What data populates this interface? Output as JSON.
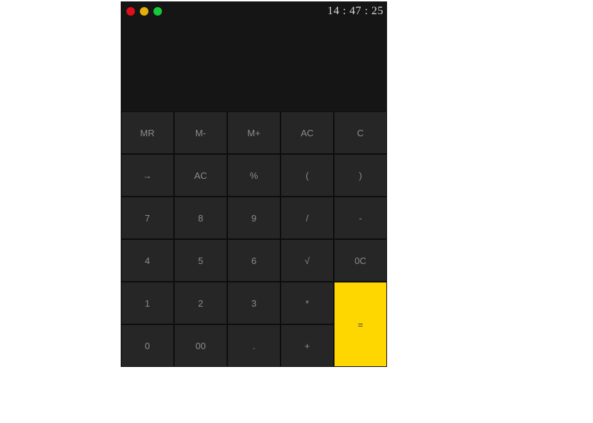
{
  "window": {
    "clock": "14 : 47 : 25",
    "controls": {
      "close_color": "#e0101a",
      "minimize_color": "#e3b00a",
      "maximize_color": "#17c93a"
    }
  },
  "display": {
    "value": ""
  },
  "keys": {
    "row1": [
      "MR",
      "M-",
      "M+",
      "AC",
      "C"
    ],
    "row2": [
      "→",
      "AC",
      "%",
      "(",
      ")"
    ],
    "row3": [
      "7",
      "8",
      "9",
      "/",
      "-"
    ],
    "row4": [
      "4",
      "5",
      "6",
      "√",
      "0C"
    ],
    "row5": [
      "1",
      "2",
      "3",
      "*"
    ],
    "row6": [
      "0",
      "00",
      ".",
      "+"
    ],
    "equals": "="
  },
  "colors": {
    "background": "#151515",
    "key": "#262626",
    "key_text": "#8c8c8c",
    "equals_accent": "#ffd700"
  }
}
